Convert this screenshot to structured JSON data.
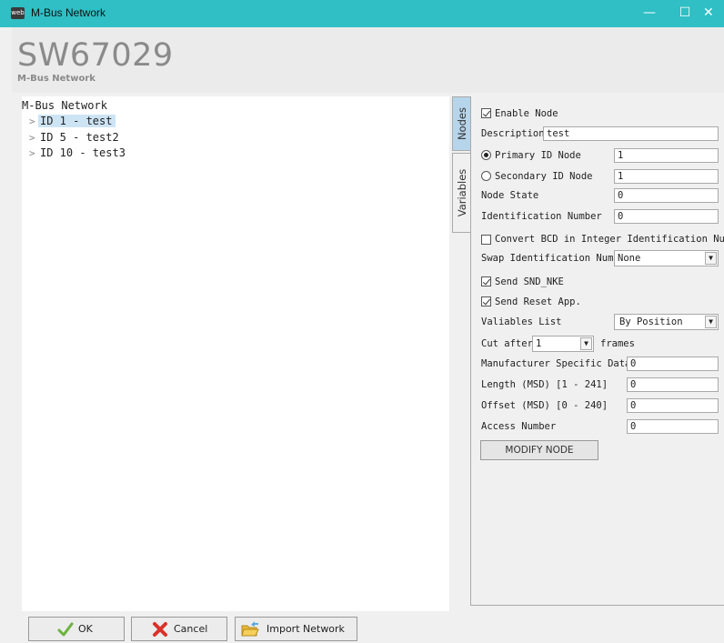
{
  "window": {
    "title": "M-Bus Network",
    "minimize": "—",
    "maximize": "☐",
    "close": "✕"
  },
  "header": {
    "code": "SW67029",
    "subtitle": "M-Bus Network"
  },
  "tree": {
    "root": "M-Bus Network",
    "items": [
      {
        "label": "ID 1 - test",
        "selected": true
      },
      {
        "label": "ID 5 - test2",
        "selected": false
      },
      {
        "label": "ID 10 - test3",
        "selected": false
      }
    ]
  },
  "tabs": {
    "nodes": "Nodes",
    "variables": "Variables",
    "active": "Nodes"
  },
  "form": {
    "enable_node": {
      "label": "Enable Node",
      "checked": true
    },
    "description": {
      "label": "Description",
      "value": "test"
    },
    "primary_id": {
      "label": "Primary ID Node",
      "value": "1",
      "selected": true
    },
    "secondary_id": {
      "label": "Secondary ID Node",
      "value": "1",
      "selected": false
    },
    "node_state": {
      "label": "Node State",
      "value": "0"
    },
    "identification_number": {
      "label": "Identification Number",
      "value": "0"
    },
    "convert_bcd": {
      "label": "Convert BCD in Integer Identification Num.",
      "checked": false
    },
    "swap_id": {
      "label": "Swap Identification Num.",
      "value": "None"
    },
    "send_snd_nke": {
      "label": "Send SND_NKE",
      "checked": true
    },
    "send_reset": {
      "label": "Send Reset App.",
      "checked": true
    },
    "variables_list": {
      "label": "Valiables List",
      "value": "By Position"
    },
    "cut_after": {
      "label": "Cut after",
      "value": "1",
      "suffix": "frames"
    },
    "manufacturer_data": {
      "label": "Manufacturer Specific Data",
      "value": "0"
    },
    "length_msd": {
      "label": "Length (MSD) [1 - 241]",
      "value": "0"
    },
    "offset_msd": {
      "label": "Offset (MSD) [0 - 240]",
      "value": "0"
    },
    "access_number": {
      "label": "Access Number",
      "value": "0"
    },
    "modify_button": "MODIFY NODE"
  },
  "footer": {
    "ok": "OK",
    "cancel": "Cancel",
    "import": "Import Network"
  }
}
